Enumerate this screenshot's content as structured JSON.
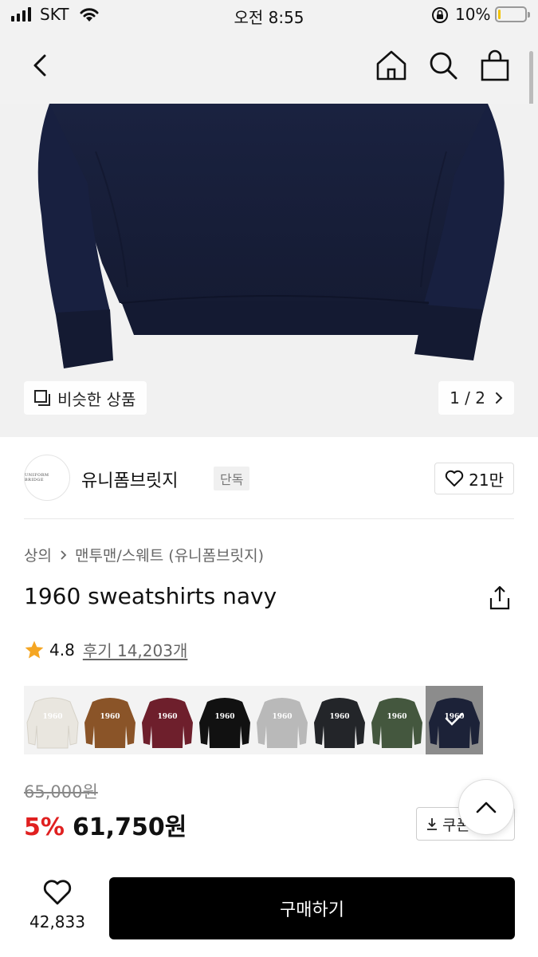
{
  "status_bar": {
    "carrier": "SKT",
    "time": "오전 8:55",
    "battery": "10%",
    "battery_level": 0.1
  },
  "nav": {
    "icons": [
      "back-icon",
      "home-icon",
      "search-icon",
      "shopping-bag-icon"
    ]
  },
  "hero": {
    "similar_label": "비슷한 상품",
    "pager": "1 / 2"
  },
  "brand": {
    "logo_text": "UNIFORM BRIDGE",
    "name": "유니폼브릿지",
    "tag": "단독",
    "likes": "21만"
  },
  "product": {
    "breadcrumb": [
      "상의",
      "맨투맨/스웨트 (유니폼브릿지)"
    ],
    "title": "1960 sweatshirts navy",
    "rating": "4.8",
    "reviews": "후기 14,203개",
    "swatches": [
      {
        "color": "#e9e6df",
        "label": "1960",
        "text_color": "#ffffff"
      },
      {
        "color": "#8a5428",
        "label": "1960",
        "text_color": "#ffffff"
      },
      {
        "color": "#6e1f2c",
        "label": "1960",
        "text_color": "#ffffff"
      },
      {
        "color": "#111111",
        "label": "1960",
        "text_color": "#ffffff"
      },
      {
        "color": "#b9b9b9",
        "label": "1960",
        "text_color": "#ffffff"
      },
      {
        "color": "#232529",
        "label": "1960",
        "text_color": "#ffffff"
      },
      {
        "color": "#44573e",
        "label": "1960",
        "text_color": "#ffffff"
      },
      {
        "color": "#1c2238",
        "label": "1960",
        "text_color": "#ffffff",
        "selected": true
      }
    ],
    "original_price": "65,000원",
    "discount": "5%",
    "sale_price": "61,750원",
    "coupon_label": "쿠폰"
  },
  "bottom_bar": {
    "wish_count": "42,833",
    "buy_label": "구매하기"
  },
  "colors": {
    "discount": "#e02020",
    "buy_button": "#000000",
    "star": "#f5a623"
  }
}
